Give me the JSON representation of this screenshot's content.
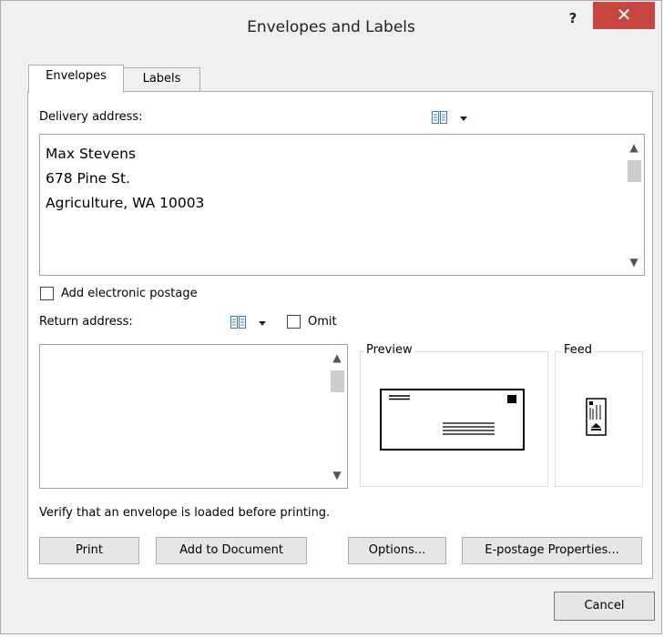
{
  "window": {
    "title": "Envelopes and Labels",
    "help_label": "?",
    "close_label": "✕"
  },
  "tabs": [
    {
      "label": "Envelopes",
      "selected": true
    },
    {
      "label": "Labels",
      "selected": false
    }
  ],
  "delivery": {
    "label": "Delivery address:",
    "address": "Max Stevens\n678 Pine St.\nAgriculture, WA 10003"
  },
  "postage": {
    "label": "Add electronic postage",
    "checked": false
  },
  "return": {
    "label": "Return address:",
    "address": "",
    "omit_label": "Omit",
    "omit_checked": false
  },
  "preview": {
    "label": "Preview"
  },
  "feed": {
    "label": "Feed"
  },
  "status_text": "Verify that an envelope is loaded before printing.",
  "buttons": {
    "print": "Print",
    "add_to_document": "Add to Document",
    "options": "Options...",
    "epostage": "E-postage Properties...",
    "cancel": "Cancel"
  },
  "colors": {
    "close_button": "#c7463f",
    "icon_blue": "#3c78c8"
  },
  "icons": {
    "address_book": "address-book-icon",
    "dropdown": "chevron-down-icon",
    "close": "close-icon",
    "help": "help-icon"
  }
}
